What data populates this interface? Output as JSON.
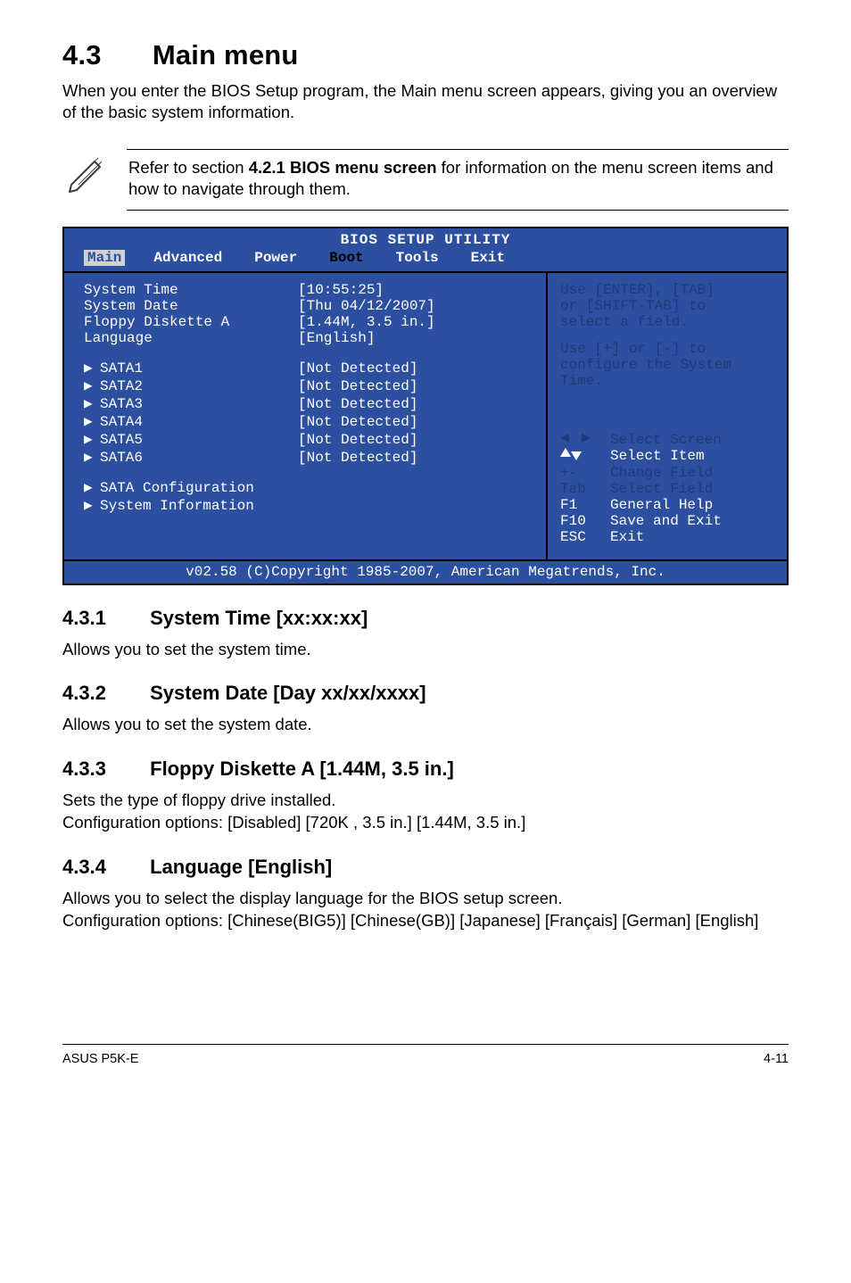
{
  "page": {
    "h1_num": "4.3",
    "h1_title": "Main menu",
    "intro": "When you enter the BIOS Setup program, the Main menu screen appears, giving you an overview of the basic system information.",
    "note_pre": "Refer to section ",
    "note_bold": "4.2.1  BIOS menu screen",
    "note_post": " for information on the menu screen items and how to navigate through them."
  },
  "bios": {
    "title": "BIOS SETUP UTILITY",
    "tabs": {
      "main": "Main",
      "advanced": "Advanced",
      "power": "Power",
      "boot": "Boot",
      "tools": "Tools",
      "exit": "Exit"
    },
    "left_top": [
      {
        "key": "System Time",
        "val": "[10:55:25]"
      },
      {
        "key": "System Date",
        "val": "[Thu 04/12/2007]"
      },
      {
        "key": "Floppy Diskette A",
        "val": "[1.44M, 3.5 in.]"
      },
      {
        "key": "Language",
        "val": "[English]"
      }
    ],
    "left_list": [
      {
        "key": "SATA1",
        "val": "[Not Detected]"
      },
      {
        "key": "SATA2",
        "val": "[Not Detected]"
      },
      {
        "key": "SATA3",
        "val": "[Not Detected]"
      },
      {
        "key": "SATA4",
        "val": "[Not Detected]"
      },
      {
        "key": "SATA5",
        "val": "[Not Detected]"
      },
      {
        "key": "SATA6",
        "val": "[Not Detected]"
      }
    ],
    "left_sub": [
      {
        "key": "SATA Configuration"
      },
      {
        "key": "System Information"
      }
    ],
    "right_top1a": "Use [ENTER], [TAB]",
    "right_top1b": "or [SHIFT-TAB] to",
    "right_top1c": "select a field.",
    "right_top2a": "Use [+] or [-] to",
    "right_top2b": "configure the System",
    "right_top2c": "Time.",
    "right_help": [
      {
        "key": "←→",
        "label": "Select Screen",
        "cls": "lh-blue",
        "arrow": "lr"
      },
      {
        "key": "↑↓",
        "label": "Select Item",
        "cls": "lh-white",
        "arrow": "ud"
      },
      {
        "key": "+-",
        "label": "Change Field",
        "cls": "lh-blue"
      },
      {
        "key": "Tab",
        "label": "Select Field",
        "cls": "lh-blue"
      },
      {
        "key": "F1",
        "label": "General Help",
        "cls": "lh-white"
      },
      {
        "key": "F10",
        "label": "Save and Exit",
        "cls": "lh-white"
      },
      {
        "key": "ESC",
        "label": "Exit",
        "cls": "lh-white"
      }
    ],
    "footer": "v02.58 (C)Copyright 1985-2007, American Megatrends, Inc."
  },
  "sections": {
    "s1_num": "4.3.1",
    "s1_title": "System Time [xx:xx:xx]",
    "s1_body": "Allows you to set the system time.",
    "s2_num": "4.3.2",
    "s2_title": "System Date [Day xx/xx/xxxx]",
    "s2_body": "Allows you to set the system date.",
    "s3_num": "4.3.3",
    "s3_title": "Floppy Diskette A [1.44M, 3.5 in.]",
    "s3_body1": "Sets the type of floppy drive installed.",
    "s3_body2": "Configuration options: [Disabled] [720K , 3.5 in.] [1.44M, 3.5 in.]",
    "s4_num": "4.3.4",
    "s4_title": "Language [English]",
    "s4_body1": "Allows you to select the display language for the BIOS setup screen.",
    "s4_body2": "Configuration options: [Chinese(BIG5)] [Chinese(GB)] [Japanese] [Français] [German] [English]"
  },
  "footer": {
    "left": "ASUS P5K-E",
    "right": "4-11"
  }
}
